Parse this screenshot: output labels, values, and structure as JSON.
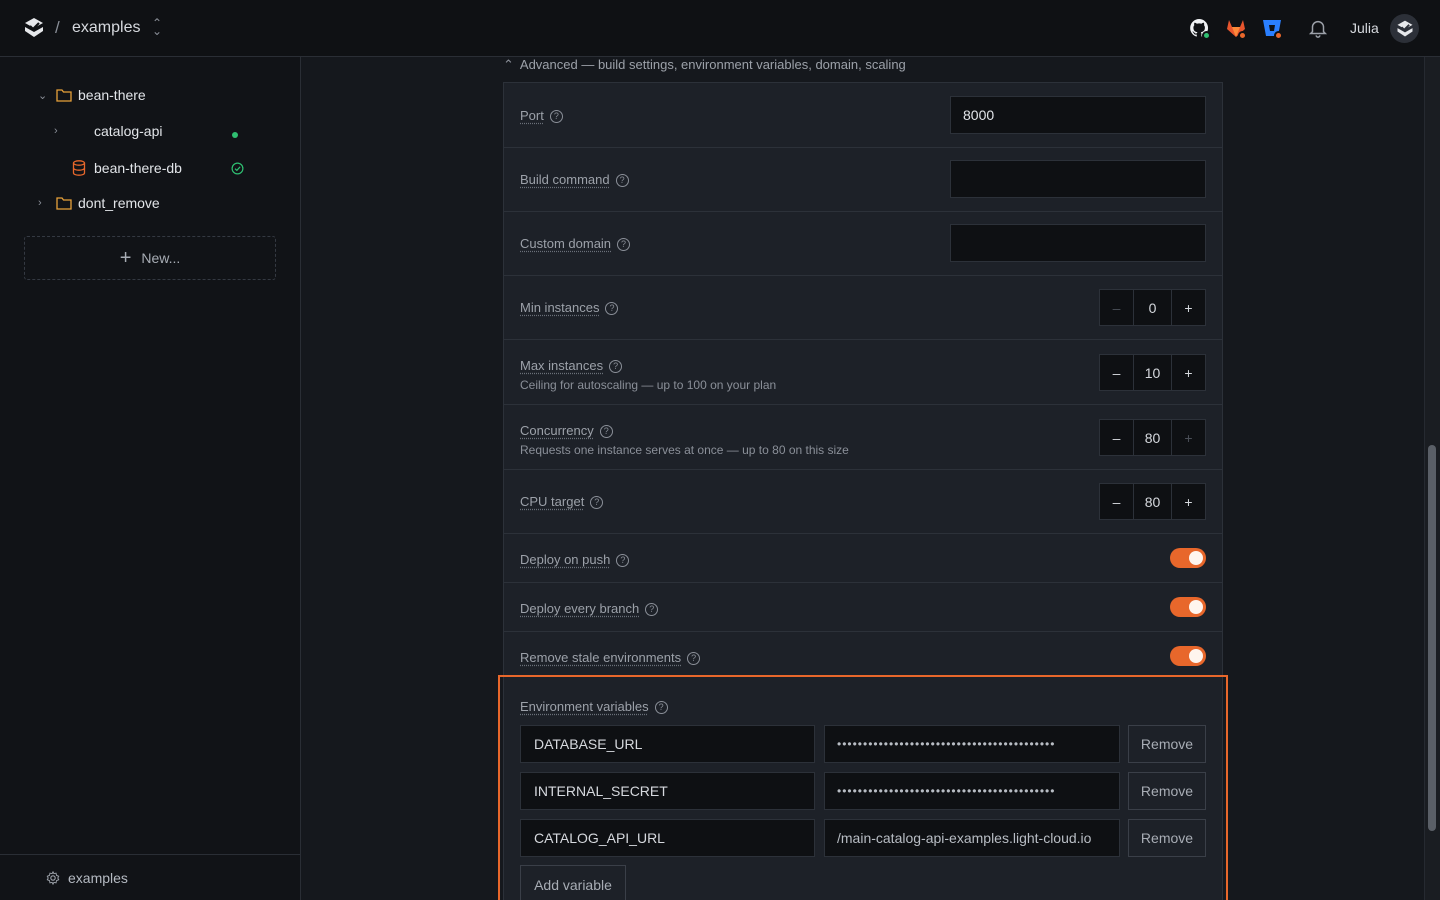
{
  "topbar": {
    "separator": "/",
    "project": "examples",
    "user_name": "Julia",
    "icons": [
      "app-logo-icon",
      "github-icon",
      "gitlab-icon",
      "bitbucket-icon",
      "bell-icon"
    ]
  },
  "sidebar": {
    "tree": [
      {
        "label": "bean-there",
        "type": "folder",
        "expanded": true
      },
      {
        "label": "catalog-api",
        "type": "service",
        "status": "running"
      },
      {
        "label": "bean-there-db",
        "type": "database",
        "status": "healthy"
      },
      {
        "label": "dont_remove",
        "type": "folder",
        "expanded": false
      }
    ],
    "new_label": "New...",
    "footer_label": "examples"
  },
  "main": {
    "advanced_label": "Advanced — build settings, environment variables, domain, scaling",
    "port": {
      "label": "Port",
      "value": "8000"
    },
    "build_command": {
      "label": "Build command",
      "value": ""
    },
    "custom_domain": {
      "label": "Custom domain",
      "value": ""
    },
    "min_instances": {
      "label": "Min instances",
      "value": "0"
    },
    "max_instances": {
      "label": "Max instances",
      "sub": "Ceiling for autoscaling — up to 100 on your plan",
      "value": "10"
    },
    "concurrency": {
      "label": "Concurrency",
      "sub": "Requests one instance serves at once — up to 80 on this size",
      "value": "80"
    },
    "cpu_target": {
      "label": "CPU target",
      "value": "80"
    },
    "deploy_on_push": {
      "label": "Deploy on push",
      "enabled": true
    },
    "deploy_every_branch": {
      "label": "Deploy every branch",
      "enabled": true
    },
    "remove_stale": {
      "label": "Remove stale environments",
      "enabled": true
    },
    "env": {
      "label": "Environment variables",
      "vars": [
        {
          "key": "DATABASE_URL",
          "value": "••••••••••••••••••••••••••••••••••••••••••"
        },
        {
          "key": "INTERNAL_SECRET",
          "value": "••••••••••••••••••••••••••••••••••••••••••"
        },
        {
          "key": "CATALOG_API_URL",
          "value": "/main-catalog-api-examples.light-cloud.io"
        }
      ],
      "remove_label": "Remove",
      "add_label": "Add variable"
    },
    "stepper_minus": "–",
    "stepper_plus": "+",
    "help_glyph": "?"
  },
  "colors": {
    "accent": "#e8672b",
    "status_green": "#2fbf71"
  }
}
